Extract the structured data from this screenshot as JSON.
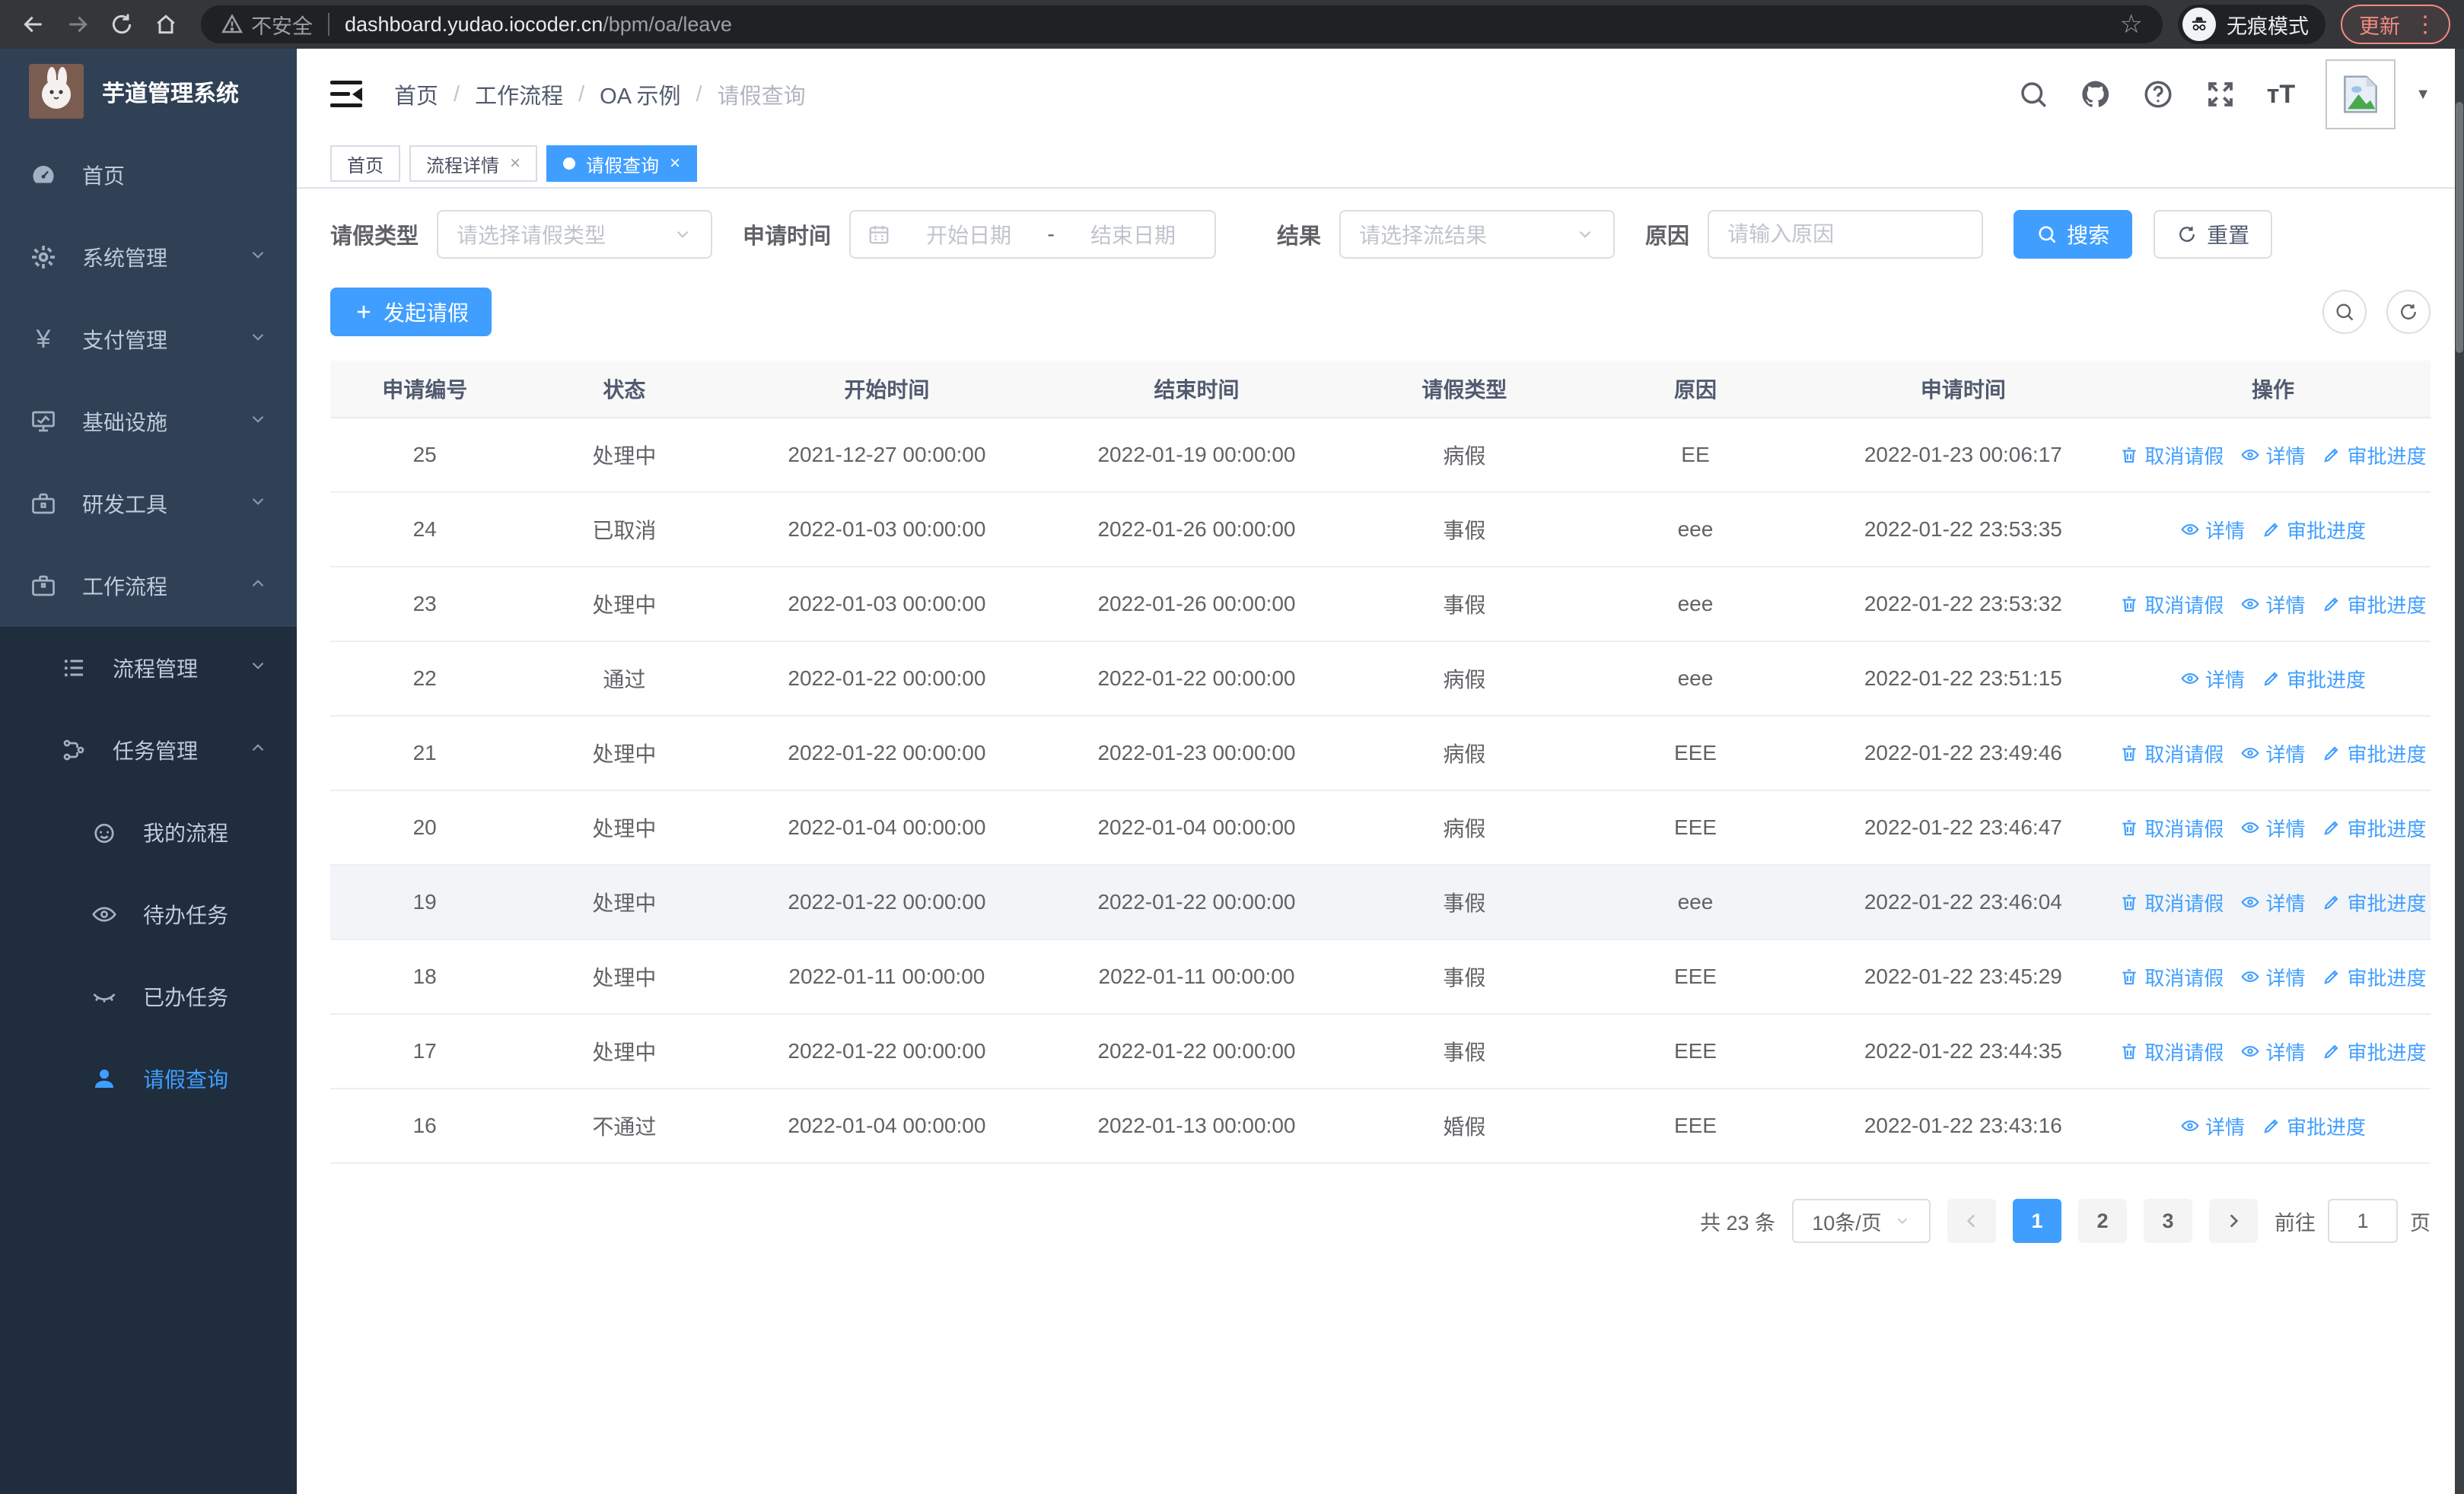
{
  "browser": {
    "security_label": "不安全",
    "url_host": "dashboard.yudao.iocoder.cn",
    "url_path": "/bpm/oa/leave",
    "incognito_label": "无痕模式",
    "update_label": "更新"
  },
  "sidebar": {
    "app_title": "芋道管理系统",
    "items": {
      "home": "首页",
      "system": "系统管理",
      "payment": "支付管理",
      "infra": "基础设施",
      "devtools": "研发工具",
      "workflow": "工作流程",
      "process_mgmt": "流程管理",
      "task_mgmt": "任务管理",
      "my_process": "我的流程",
      "todo_tasks": "待办任务",
      "done_tasks": "已办任务",
      "leave_query": "请假查询"
    }
  },
  "header": {
    "breadcrumb": {
      "home": "首页",
      "workflow": "工作流程",
      "oa": "OA 示例",
      "current": "请假查询"
    }
  },
  "tabs": {
    "home": "首页",
    "process_detail": "流程详情",
    "leave_query": "请假查询"
  },
  "filters": {
    "leave_type_label": "请假类型",
    "leave_type_placeholder": "请选择请假类型",
    "apply_time_label": "申请时间",
    "date_start_placeholder": "开始日期",
    "date_separator": "-",
    "date_end_placeholder": "结束日期",
    "result_label": "结果",
    "result_placeholder": "请选择流结果",
    "reason_label": "原因",
    "reason_placeholder": "请输入原因",
    "search_label": "搜索",
    "reset_label": "重置"
  },
  "toolbar": {
    "create_label": "发起请假"
  },
  "table": {
    "columns": [
      "申请编号",
      "状态",
      "开始时间",
      "结束时间",
      "请假类型",
      "原因",
      "申请时间",
      "操作"
    ],
    "action_labels": {
      "cancel": "取消请假",
      "detail": "详情",
      "progress": "审批进度"
    },
    "rows": [
      {
        "id": "25",
        "status": "处理中",
        "start": "2021-12-27 00:00:00",
        "end": "2022-01-19 00:00:00",
        "type": "病假",
        "reason": "EE",
        "applied": "2022-01-23 00:06:17",
        "actions": [
          "cancel",
          "detail",
          "progress"
        ],
        "highlight": false
      },
      {
        "id": "24",
        "status": "已取消",
        "start": "2022-01-03 00:00:00",
        "end": "2022-01-26 00:00:00",
        "type": "事假",
        "reason": "eee",
        "applied": "2022-01-22 23:53:35",
        "actions": [
          "detail",
          "progress"
        ],
        "highlight": false
      },
      {
        "id": "23",
        "status": "处理中",
        "start": "2022-01-03 00:00:00",
        "end": "2022-01-26 00:00:00",
        "type": "事假",
        "reason": "eee",
        "applied": "2022-01-22 23:53:32",
        "actions": [
          "cancel",
          "detail",
          "progress"
        ],
        "highlight": false
      },
      {
        "id": "22",
        "status": "通过",
        "start": "2022-01-22 00:00:00",
        "end": "2022-01-22 00:00:00",
        "type": "病假",
        "reason": "eee",
        "applied": "2022-01-22 23:51:15",
        "actions": [
          "detail",
          "progress"
        ],
        "highlight": false
      },
      {
        "id": "21",
        "status": "处理中",
        "start": "2022-01-22 00:00:00",
        "end": "2022-01-23 00:00:00",
        "type": "病假",
        "reason": "EEE",
        "applied": "2022-01-22 23:49:46",
        "actions": [
          "cancel",
          "detail",
          "progress"
        ],
        "highlight": false
      },
      {
        "id": "20",
        "status": "处理中",
        "start": "2022-01-04 00:00:00",
        "end": "2022-01-04 00:00:00",
        "type": "病假",
        "reason": "EEE",
        "applied": "2022-01-22 23:46:47",
        "actions": [
          "cancel",
          "detail",
          "progress"
        ],
        "highlight": false
      },
      {
        "id": "19",
        "status": "处理中",
        "start": "2022-01-22 00:00:00",
        "end": "2022-01-22 00:00:00",
        "type": "事假",
        "reason": "eee",
        "applied": "2022-01-22 23:46:04",
        "actions": [
          "cancel",
          "detail",
          "progress"
        ],
        "highlight": true
      },
      {
        "id": "18",
        "status": "处理中",
        "start": "2022-01-11 00:00:00",
        "end": "2022-01-11 00:00:00",
        "type": "事假",
        "reason": "EEE",
        "applied": "2022-01-22 23:45:29",
        "actions": [
          "cancel",
          "detail",
          "progress"
        ],
        "highlight": false
      },
      {
        "id": "17",
        "status": "处理中",
        "start": "2022-01-22 00:00:00",
        "end": "2022-01-22 00:00:00",
        "type": "事假",
        "reason": "EEE",
        "applied": "2022-01-22 23:44:35",
        "actions": [
          "cancel",
          "detail",
          "progress"
        ],
        "highlight": false
      },
      {
        "id": "16",
        "status": "不通过",
        "start": "2022-01-04 00:00:00",
        "end": "2022-01-13 00:00:00",
        "type": "婚假",
        "reason": "EEE",
        "applied": "2022-01-22 23:43:16",
        "actions": [
          "detail",
          "progress"
        ],
        "highlight": false
      }
    ]
  },
  "pagination": {
    "total": "共 23 条",
    "page_size": "10条/页",
    "pages": [
      "1",
      "2",
      "3"
    ],
    "active_page": "1",
    "goto_label": "前往",
    "goto_value": "1",
    "page_unit": "页"
  },
  "colors": {
    "accent": "#409eff",
    "sidebar_bg": "#304156",
    "submenu_bg": "#1f2d3d",
    "update_badge": "#f28b82"
  }
}
